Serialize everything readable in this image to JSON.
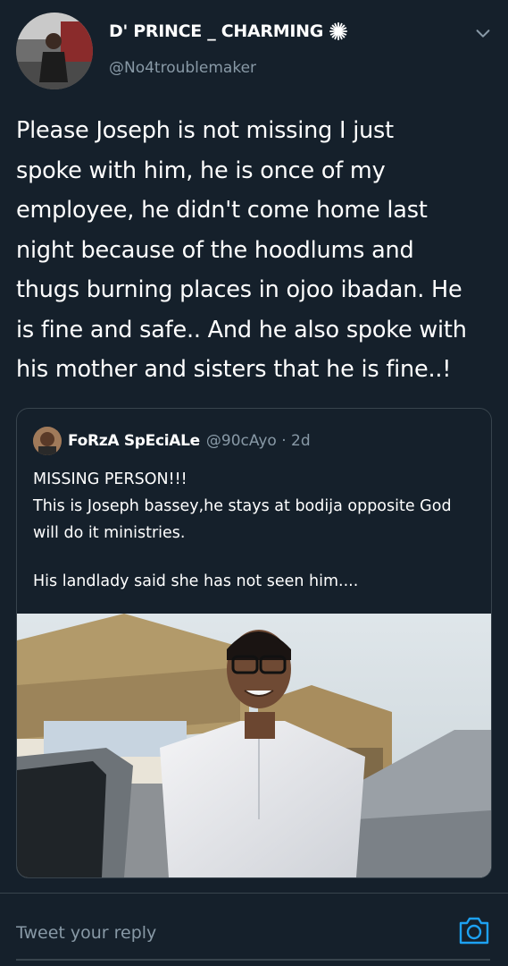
{
  "tweet": {
    "display_name": "D' PRINCE _ CHARMING",
    "handle": "@No4troublemaker",
    "lines": [
      "Please Joseph is not missing I just",
      "spoke with him, he is once of my",
      "employee, he didn't come home last",
      "night because of the hoodlums and",
      "thugs burning places in ojoo ibadan. He",
      "is fine and safe.. And he also spoke with",
      "his mother and sisters that he is fine..!"
    ]
  },
  "quote": {
    "display_name": "FoRzA SpEciALe",
    "meta": "@90cAyo · 2d",
    "line1": "MISSING PERSON!!!",
    "line2": "This is Joseph bassey,he stays at bodija opposite God",
    "line3": "will do it ministries.",
    "line4": "His landlady said she has not seen him...."
  },
  "reply": {
    "placeholder": "Tweet your reply"
  },
  "icons": {
    "verified_like": "spark-icon",
    "menu": "chevron-down-icon",
    "camera": "camera-icon"
  },
  "colors": {
    "background": "#15202b",
    "secondary_text": "#8899a6",
    "accent": "#1da1f2",
    "border": "#38444d"
  }
}
